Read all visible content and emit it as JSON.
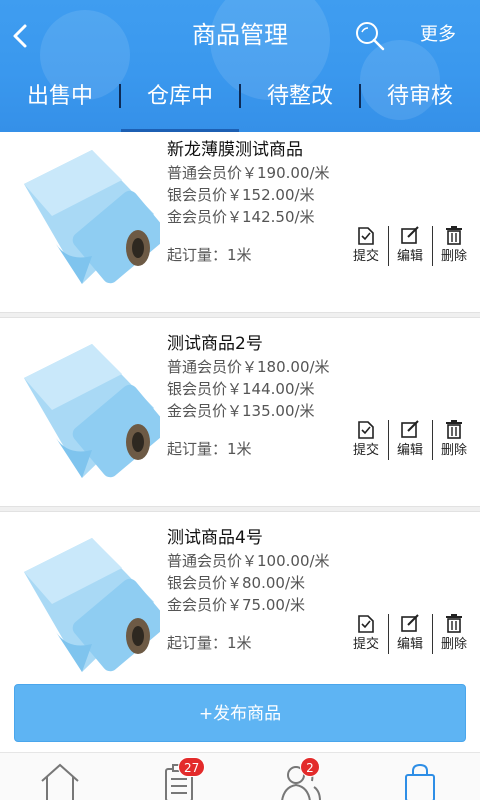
{
  "header": {
    "title": "商品管理",
    "more_label": "更多",
    "back_icon": "back-arrow-icon",
    "search_icon": "search-icon",
    "bg_color": "#3a98ee"
  },
  "tabs": [
    {
      "label": "出售中",
      "active": false
    },
    {
      "label": "仓库中",
      "active": true
    },
    {
      "label": "待整改",
      "active": false
    },
    {
      "label": "待审核",
      "active": false
    }
  ],
  "products": [
    {
      "name": "新龙薄膜测试商品",
      "price_normal": "普通会员价￥190.00/米",
      "price_silver": "银会员价￥152.00/米",
      "price_gold": "金会员价￥142.50/米",
      "moq": "起订量：1米"
    },
    {
      "name": "测试商品2号",
      "price_normal": "普通会员价￥180.00/米",
      "price_silver": "银会员价￥144.00/米",
      "price_gold": "金会员价￥135.00/米",
      "moq": "起订量：1米"
    },
    {
      "name": "测试商品4号",
      "price_normal": "普通会员价￥100.00/米",
      "price_silver": "银会员价￥80.00/米",
      "price_gold": "金会员价￥75.00/米",
      "moq": "起订量：1米"
    }
  ],
  "actions": {
    "submit": "提交",
    "edit": "编辑",
    "delete": "删除"
  },
  "publish_button": "+发布商品",
  "bottom_nav": {
    "home_icon": "home-icon",
    "orders_icon": "order-list-icon",
    "orders_badge": "27",
    "members_icon": "users-icon",
    "members_badge": "2",
    "shop_icon": "shopping-bag-icon"
  },
  "colors": {
    "accent": "#3a98ee",
    "button": "#5eb4f3",
    "badge": "#e32b2b"
  }
}
